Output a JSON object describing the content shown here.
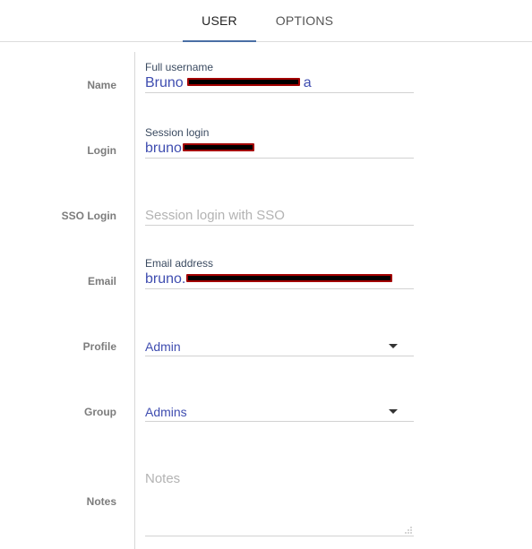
{
  "tabs": [
    {
      "label": "USER",
      "active": true
    },
    {
      "label": "OPTIONS",
      "active": false
    }
  ],
  "accent_color": "#4a6fa5",
  "value_color": "#3f4db0",
  "rows": {
    "name": {
      "label": "Name",
      "field_label": "Full username",
      "value_prefix": "Bruno",
      "value_suffix": "a"
    },
    "login": {
      "label": "Login",
      "field_label": "Session login",
      "value_prefix": "bruno"
    },
    "sso": {
      "label": "SSO Login",
      "placeholder": "Session login with SSO"
    },
    "email": {
      "label": "Email",
      "field_label": "Email address",
      "value_prefix": "bruno."
    },
    "profile": {
      "label": "Profile",
      "selected": "Admin"
    },
    "group": {
      "label": "Group",
      "selected": "Admins"
    },
    "notes": {
      "label": "Notes",
      "placeholder": "Notes"
    }
  }
}
